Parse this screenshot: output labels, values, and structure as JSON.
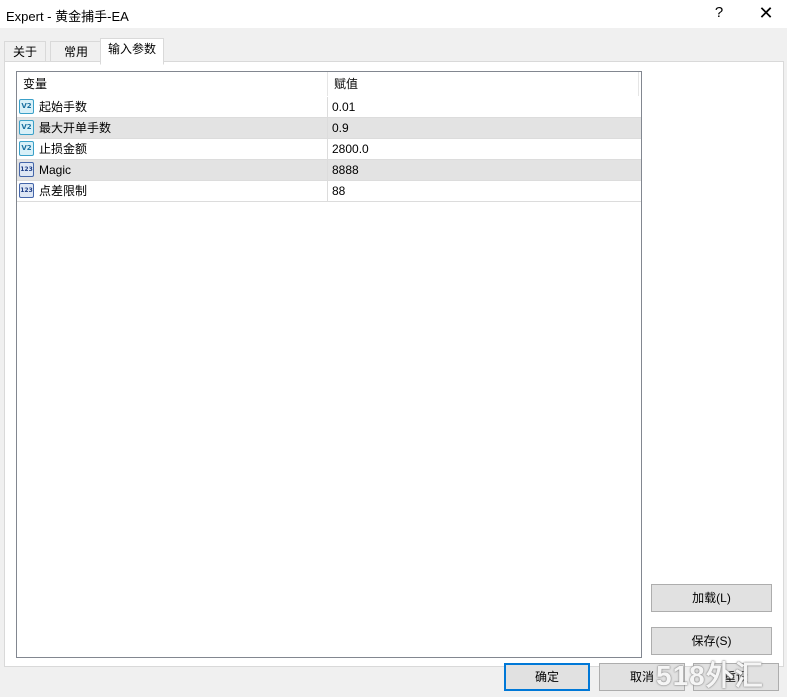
{
  "window": {
    "title": "Expert - 黄金捕手-EA",
    "help_glyph": "?",
    "close_glyph": "✕"
  },
  "tabs": [
    {
      "label": "关于",
      "active": false
    },
    {
      "label": "常用",
      "active": false
    },
    {
      "label": "输入参数",
      "active": true
    }
  ],
  "grid": {
    "columns": [
      "变量",
      "赋值"
    ],
    "rows": [
      {
        "icon": "v2-double-icon",
        "icon_text": "V2",
        "variable": "起始手数",
        "value": "0.01"
      },
      {
        "icon": "v2-double-icon",
        "icon_text": "V2",
        "variable": "最大开单手数",
        "value": "0.9"
      },
      {
        "icon": "v2-double-icon",
        "icon_text": "V2",
        "variable": "止损金额",
        "value": "2800.0"
      },
      {
        "icon": "int-123-icon",
        "icon_text": "123",
        "variable": "Magic",
        "value": "8888"
      },
      {
        "icon": "int-123-icon",
        "icon_text": "123",
        "variable": "点差限制",
        "value": "88"
      }
    ]
  },
  "buttons": {
    "load": "加载(L)",
    "save": "保存(S)",
    "ok": "确定",
    "cancel": "取消",
    "reset": "重设"
  },
  "watermark": "518外汇网",
  "colors": {
    "accent": "#0078d7",
    "row_alt": "#e3e3e3",
    "background": "#f0f0f0"
  }
}
